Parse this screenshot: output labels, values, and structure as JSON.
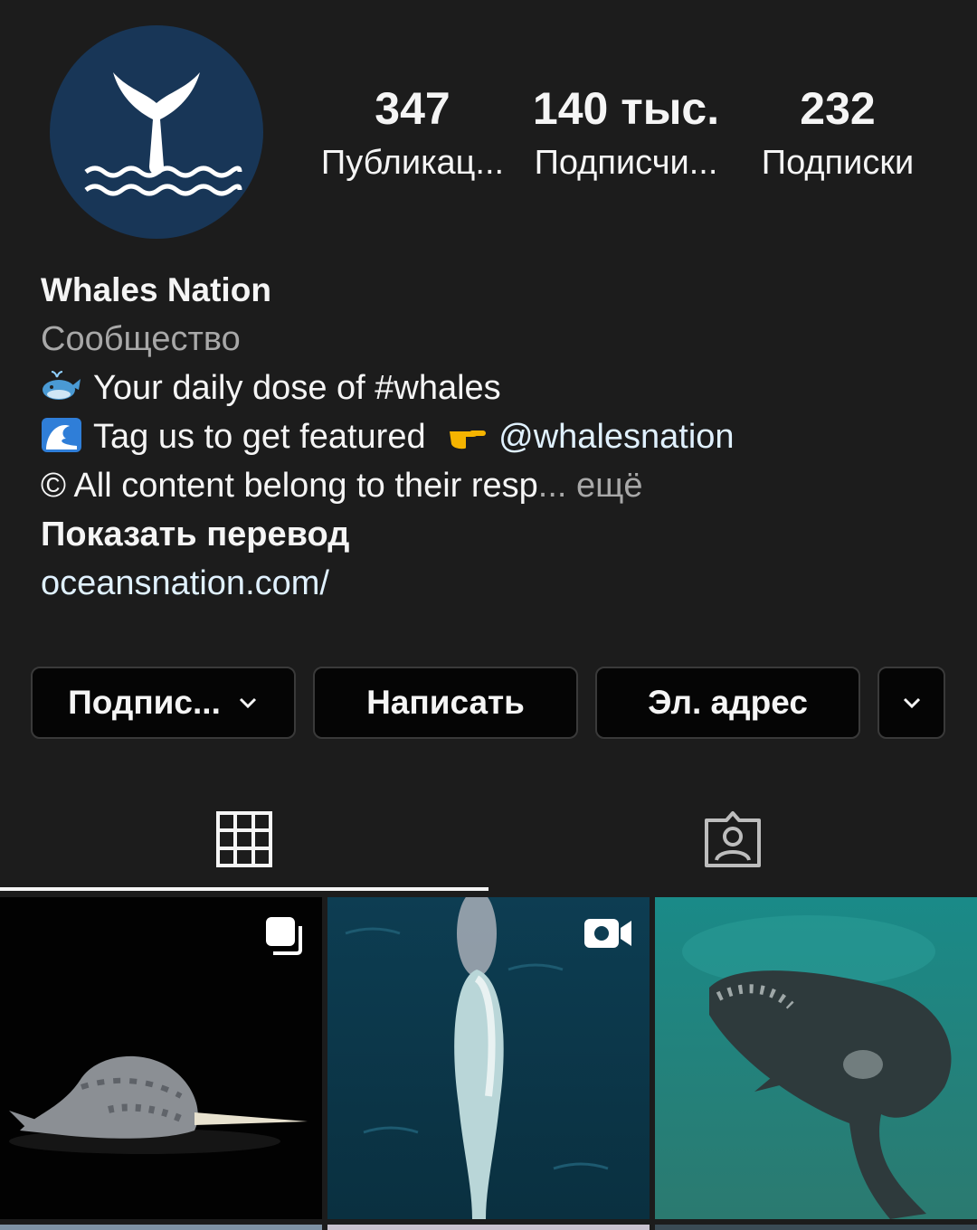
{
  "profile": {
    "name": "Whales Nation",
    "category": "Сообщество",
    "bio_line1": "Your daily dose of #whales",
    "bio_line2": "Tag us to get featured",
    "bio_line2_handle": "@whalesnation",
    "bio_line3": "© All content belong to their resp",
    "bio_more_ellipsis": "...",
    "bio_more": "ещё",
    "translate": "Показать перевод",
    "link": "oceansnation.com/"
  },
  "stats": {
    "posts_count": "347",
    "posts_label": "Публикац...",
    "followers_count": "140 тыс.",
    "followers_label": "Подписчи...",
    "following_count": "232",
    "following_label": "Подписки"
  },
  "actions": {
    "follow": "Подпис...",
    "message": "Написать",
    "email": "Эл. адрес"
  },
  "tabs": {
    "active": "grid",
    "items": [
      "grid-icon",
      "tagged-icon"
    ]
  },
  "grid": {
    "tiles": [
      {
        "subject": "narwhal plush toy",
        "badge": "carousel-icon"
      },
      {
        "subject": "aerial view of blue whale",
        "badge": "reel-icon"
      },
      {
        "subject": "underwater right whale",
        "badge": ""
      }
    ]
  },
  "colors": {
    "background": "#1c1c1c",
    "avatar_bg": "#183657",
    "button_bg": "#050505",
    "muted_text": "#a8a8a8",
    "link_text": "#e0f1ff"
  }
}
